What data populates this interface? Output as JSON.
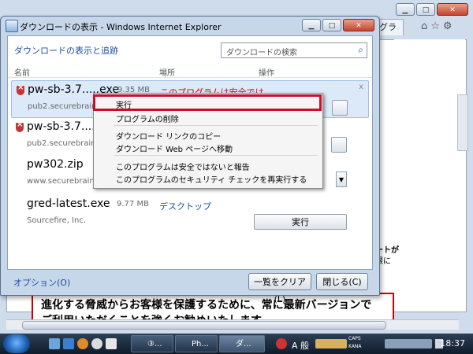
{
  "dialog": {
    "title": "ダウンロードの表示 - Windows Internet Explorer",
    "link": "ダウンロードの表示と追跡",
    "search_placeholder": "ダウンロードの検索",
    "columns": {
      "name": "名前",
      "location": "場所",
      "actions": "操作"
    },
    "items": [
      {
        "name": "pw-sb-3.7.....exe",
        "size": "9.35 MB",
        "location": "このプログラムは安全では",
        "source": "pub2.securebrain.com"
      },
      {
        "name": "pw-sb-3.7.....exe",
        "size": "",
        "location": "",
        "source": "pub2.securebrain.com"
      },
      {
        "name": "pw302.zip",
        "size": "",
        "location": "",
        "source": "www.securebrain.co"
      },
      {
        "name": "gred-latest.exe",
        "size": "9.77 MB",
        "location": "デスクトップ",
        "source": "Sourcefire, Inc.",
        "action": "実行"
      }
    ],
    "options_link": "オプション(O)",
    "clear_button": "一覧をクリア(L)",
    "close_button": "閉じる(C)",
    "close_glyph": "x"
  },
  "context_menu": {
    "items": [
      "実行",
      "プログラムの削除",
      "ダウンロード リンクのコピー",
      "ダウンロード Web ページへ移動",
      "このプログラムは安全ではないと報告",
      "このプログラムのセキュリティ チェックを再実行する"
    ]
  },
  "background": {
    "tab_label": "グラ",
    "side_text_1": "ートが",
    "side_text_2": "限に",
    "banner_line1": "進化する脅威からお客様を保護するために、常に最新バージョンで",
    "banner_line2": "ご利用いただくことを強くお勧めいたします。"
  },
  "taskbar": {
    "items": [
      "③...",
      "Ph...",
      "ダ..."
    ],
    "ime": "A 般",
    "caps": "CAPS",
    "kana": "KANA",
    "clock": "18:37"
  },
  "colors": {
    "highlight": "#c8102e",
    "link": "#1a4fa0",
    "warning": "#cc0000"
  }
}
